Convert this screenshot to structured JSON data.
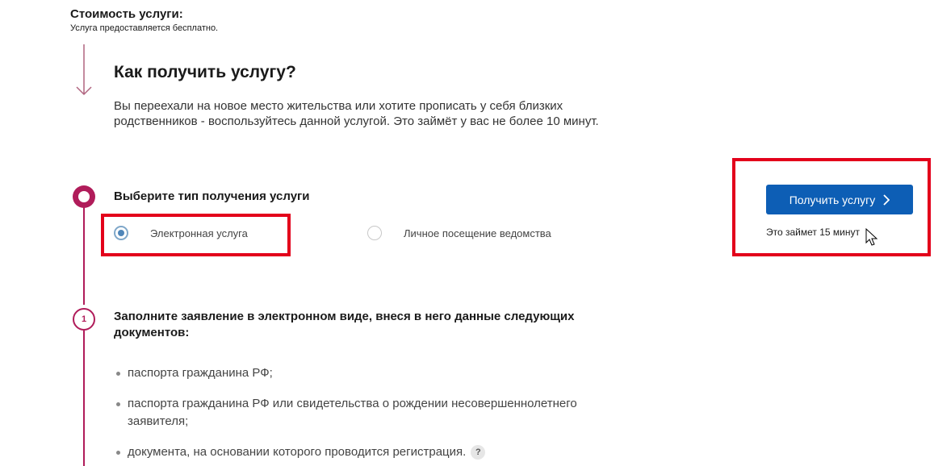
{
  "cost": {
    "title": "Стоимость услуги:",
    "text": "Услуга предоставляется бесплатно."
  },
  "how": {
    "title": "Как получить услугу?",
    "description": "Вы переехали на новое место жительства или хотите прописать у себя близких родственников - воспользуйтесь данной услугой. Это займёт у вас не более 10 минут."
  },
  "step_choose": {
    "title": "Выберите тип получения услуги",
    "options": [
      {
        "label": "Электронная услуга",
        "selected": true
      },
      {
        "label": "Личное посещение ведомства",
        "selected": false
      }
    ]
  },
  "action": {
    "button_label": "Получить услугу",
    "takes_time": "Это займет 15 минут"
  },
  "step_fill": {
    "number": "1",
    "title": "Заполните заявление в электронном виде, внеся в него данные следующих документов:",
    "documents": [
      "паспорта гражданина РФ;",
      "паспорта гражданина РФ или свидетельства о рождении несовершеннолетнего заявителя;",
      "документа, на основании которого проводится регистрация."
    ],
    "help_icon_glyph": "?"
  },
  "colors": {
    "accent": "#b01c5a",
    "button": "#0d5eb5",
    "highlight": "#e3001b",
    "radio_selected": "#4f86b9"
  },
  "icons": [
    "arrow-down-icon",
    "chevron-right-icon",
    "mouse-cursor-icon",
    "help-icon"
  ]
}
